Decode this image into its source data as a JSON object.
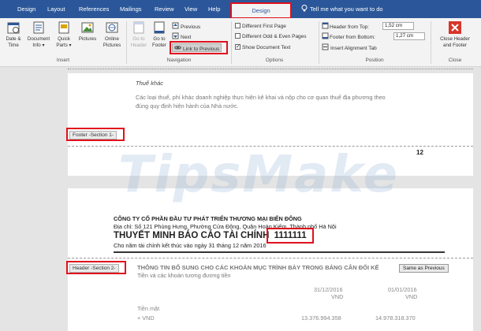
{
  "tabs": [
    "Design",
    "Layout",
    "References",
    "Mailings",
    "Review",
    "View",
    "Help"
  ],
  "context_tab": "Design",
  "tell_me": "Tell me what you want to do",
  "ribbon": {
    "insert": {
      "label": "Insert",
      "date_time": "Date &\nTime",
      "document_info": "Document\nInfo ▾",
      "quick_parts": "Quick\nParts ▾",
      "pictures": "Pictures",
      "online_pictures": "Online\nPictures"
    },
    "navigation": {
      "label": "Navigation",
      "go_to_header": "Go to\nHeader",
      "go_to_footer": "Go to\nFooter",
      "previous": "Previous",
      "next": "Next",
      "link_to_previous": "Link to Previous"
    },
    "options": {
      "label": "Options",
      "different_first_page": "Different First Page",
      "different_odd_even": "Different Odd & Even Pages",
      "show_document_text": "Show Document Text"
    },
    "position": {
      "label": "Position",
      "header_from_top": "Header from Top:",
      "header_from_top_value": "1,52 cm",
      "footer_from_bottom": "Footer from Bottom:",
      "footer_from_bottom_value": "1,27 cm",
      "insert_alignment_tab": "Insert Alignment Tab"
    },
    "close": {
      "label": "Close",
      "close_header_footer": "Close Header\nand Footer"
    }
  },
  "page1": {
    "heading": "Thuế khác",
    "line1": "Các loại thuế, phí khác doanh nghiệp thực hiện kê khai và nộp cho cơ quan thuế địa phương theo",
    "line2": "đúng quy định hiện hành của Nhà nước.",
    "footer_tag": "Footer -Section 1-",
    "page_number": "12"
  },
  "page2": {
    "company": "CÔNG TY CỔ PHẦN ĐẦU TƯ PHÁT TRIỂN THƯƠNG MẠI BIỂN ĐÔNG",
    "address": "Địa chỉ: Số 121 Phùng Hưng, Phường Cửa Đông, Quận Hoàn Kiếm, Thành phố Hà Nội",
    "title": "THUYẾT MINH BÁO CÁO TÀI CHÍNH",
    "title_code": "1111111",
    "period": "Cho năm tài chính kết thúc vào ngày 31 tháng 12 năm 2016",
    "header_tag": "Header -Section 2-",
    "same_as_previous": "Same as Previous",
    "section_title": "THÔNG TIN BỔ SUNG CHO CÁC KHOẢN MỤC TRÌNH BÀY TRONG BẢNG CÂN ĐỐI KẾ",
    "section_sub": "Tiền và các khoản tương đương tiền",
    "col1_date": "31/12/2016",
    "col1_unit": "VND",
    "col2_date": "01/01/2016",
    "col2_unit": "VND",
    "row_label": "Tiền mặt",
    "row_sub": "+ VND",
    "row_val1": "13.376.994.358",
    "row_val2": "14.978.318.370"
  },
  "watermark": "TipsMake",
  "colors": {
    "ribbon_blue": "#2b579a",
    "highlight_red": "#e0101c"
  }
}
